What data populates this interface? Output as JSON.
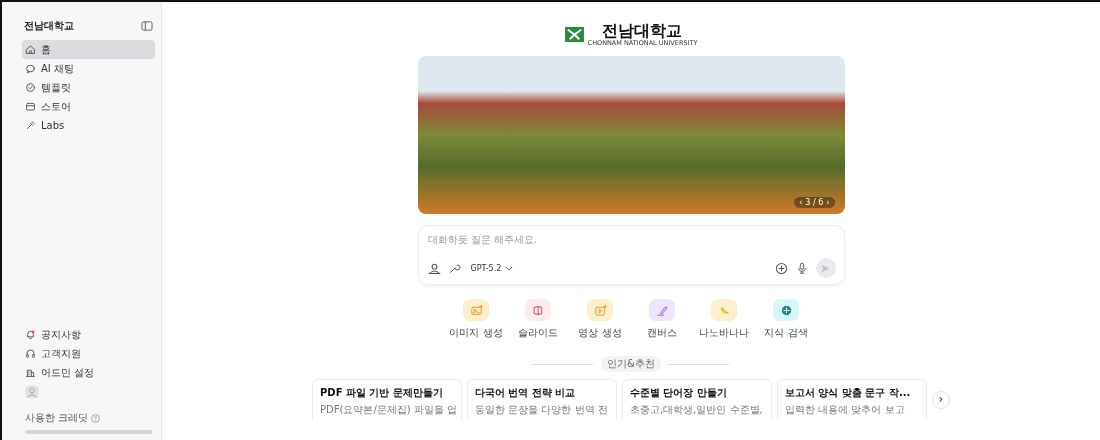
{
  "sidebar": {
    "title": "전남대학교",
    "items": [
      {
        "kind": "home",
        "label": "홈",
        "selected": true
      },
      {
        "kind": "chat",
        "label": "AI 채팅",
        "selected": false
      },
      {
        "kind": "template",
        "label": "템플릿",
        "selected": false
      },
      {
        "kind": "store",
        "label": "스토어",
        "selected": false
      },
      {
        "kind": "labs",
        "label": "Labs",
        "selected": false
      }
    ],
    "bottom_items": [
      {
        "kind": "notice",
        "label": "공지사항"
      },
      {
        "kind": "support",
        "label": "고객지원"
      },
      {
        "kind": "admin",
        "label": "어드민 설정"
      }
    ],
    "credit": {
      "label": "사용한 크레딧"
    }
  },
  "logo": {
    "name": "전남대학교",
    "subtitle": "CHONNAM NATIONAL UNIVERSITY"
  },
  "banner": {
    "prev": "‹",
    "counter": "3 / 6",
    "next": "›"
  },
  "composer": {
    "placeholder": "대화하듯 질문 해주세요.",
    "model": "GPT-5.2"
  },
  "quick_actions": [
    {
      "kind": "image",
      "label": "이미지 생성",
      "color": "#fdf0cf"
    },
    {
      "kind": "slide",
      "label": "슬라이드",
      "color": "#fdecec"
    },
    {
      "kind": "video",
      "label": "영상 생성",
      "color": "#fdf0cf"
    },
    {
      "kind": "canvas",
      "label": "캔버스",
      "color": "#efe6fd"
    },
    {
      "kind": "banana",
      "label": "나노바나나",
      "color": "#fdf0cf"
    },
    {
      "kind": "search",
      "label": "지식 검색",
      "color": "#d9f7f7"
    }
  ],
  "section_label": "인기&추천",
  "cards": [
    {
      "title": "PDF 파일 기반 문제만들기",
      "description": "PDF(요약본/문제집) 파일을 업"
    },
    {
      "title": "다국어 번역 전략 비교",
      "description": "동일한 문장을 다양한 번역 전"
    },
    {
      "title": "수준별 단어장 만들기",
      "description": "초중고,대학생,일반인 수준별,"
    },
    {
      "title": "보고서 양식 맞춤 문구 작...",
      "description": "입력한 내용에 맞추어 보고"
    }
  ],
  "cards_next": "›"
}
